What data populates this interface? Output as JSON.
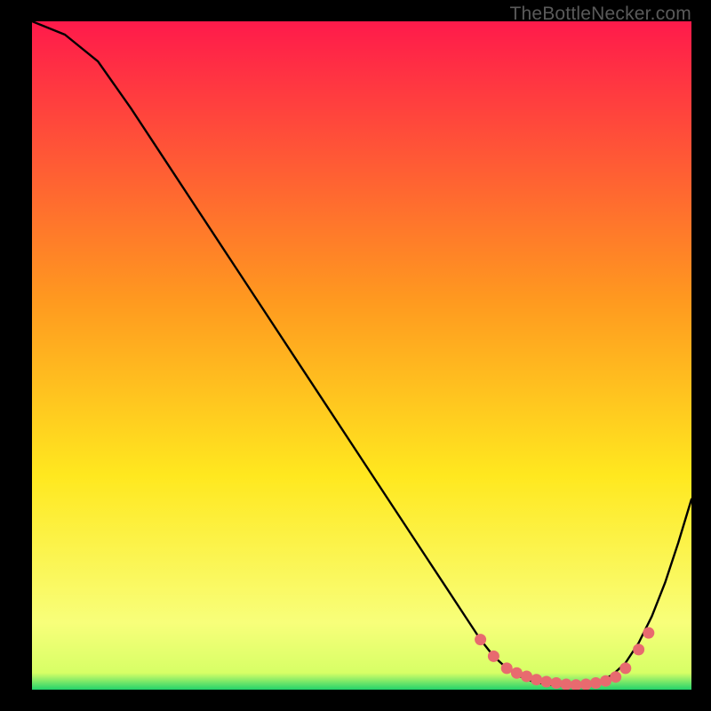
{
  "watermark": "TheBottleNecker.com",
  "colors": {
    "top": "#ff1a4b",
    "mid": "#ffd400",
    "nearBottom": "#f8ff7a",
    "bottom": "#23d36b",
    "line": "#000000",
    "marker": "#e86a6f"
  },
  "chart_data": {
    "type": "line",
    "title": "",
    "xlabel": "",
    "ylabel": "",
    "xlim": [
      0,
      100
    ],
    "ylim": [
      0,
      100
    ],
    "x": [
      0,
      5,
      10,
      15,
      20,
      25,
      30,
      35,
      40,
      45,
      50,
      55,
      60,
      63,
      66,
      68,
      70,
      72,
      74,
      76,
      78,
      80,
      82,
      84,
      86,
      88,
      90,
      92,
      94,
      96,
      98,
      100
    ],
    "values": [
      100,
      98,
      94,
      87,
      79.5,
      72,
      64.5,
      57,
      49.5,
      42,
      34.5,
      27,
      19.5,
      15,
      10.5,
      7.5,
      5,
      3.2,
      2,
      1.2,
      0.8,
      0.6,
      0.6,
      0.8,
      1.2,
      2.2,
      4,
      7,
      11,
      16,
      22,
      28.5
    ],
    "markers_x": [
      68,
      70,
      72,
      73.5,
      75,
      76.5,
      78,
      79.5,
      81,
      82.5,
      84,
      85.5,
      87,
      88.5,
      90,
      92,
      93.5
    ],
    "markers_y": [
      7.5,
      5,
      3.2,
      2.5,
      2,
      1.5,
      1.2,
      1,
      0.8,
      0.7,
      0.8,
      1,
      1.3,
      1.9,
      3.2,
      6,
      8.5
    ]
  }
}
